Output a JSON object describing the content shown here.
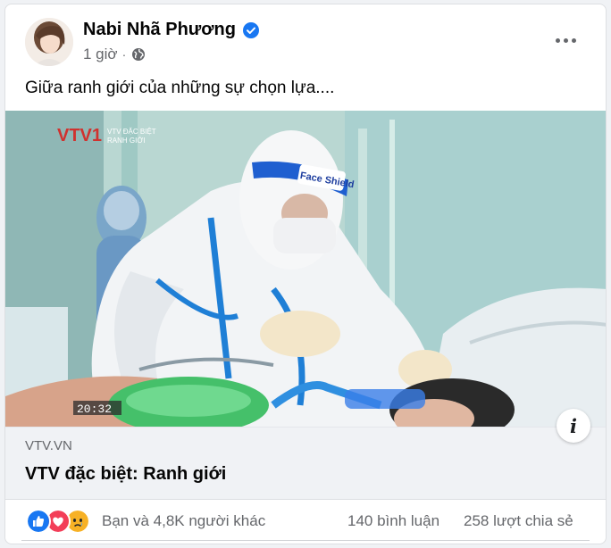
{
  "post": {
    "author": "Nabi Nhã Phương",
    "time": "1 giờ",
    "caption": "Giữa ranh giới của những sự chọn lựa....",
    "audience_icon": "globe-icon"
  },
  "media": {
    "channel_logo": "VTV1",
    "program_tag_line1": "VTV ĐẶC BIỆT",
    "program_tag_line2": "RANH GIỚI",
    "face_shield_text": "Face Shield",
    "timestamp": "20:32"
  },
  "link": {
    "domain": "VTV.VN",
    "title": "VTV đặc biệt: Ranh giới",
    "info_label": "i"
  },
  "stats": {
    "reactions_text": "Bạn và 4,8K người khác",
    "comments": "140 bình luận",
    "shares": "258 lượt chia sẻ"
  },
  "colors": {
    "brand_blue": "#1877f2",
    "love_red": "#f33e58",
    "sad_yellow": "#f7b125",
    "secondary_text": "#65676b"
  }
}
